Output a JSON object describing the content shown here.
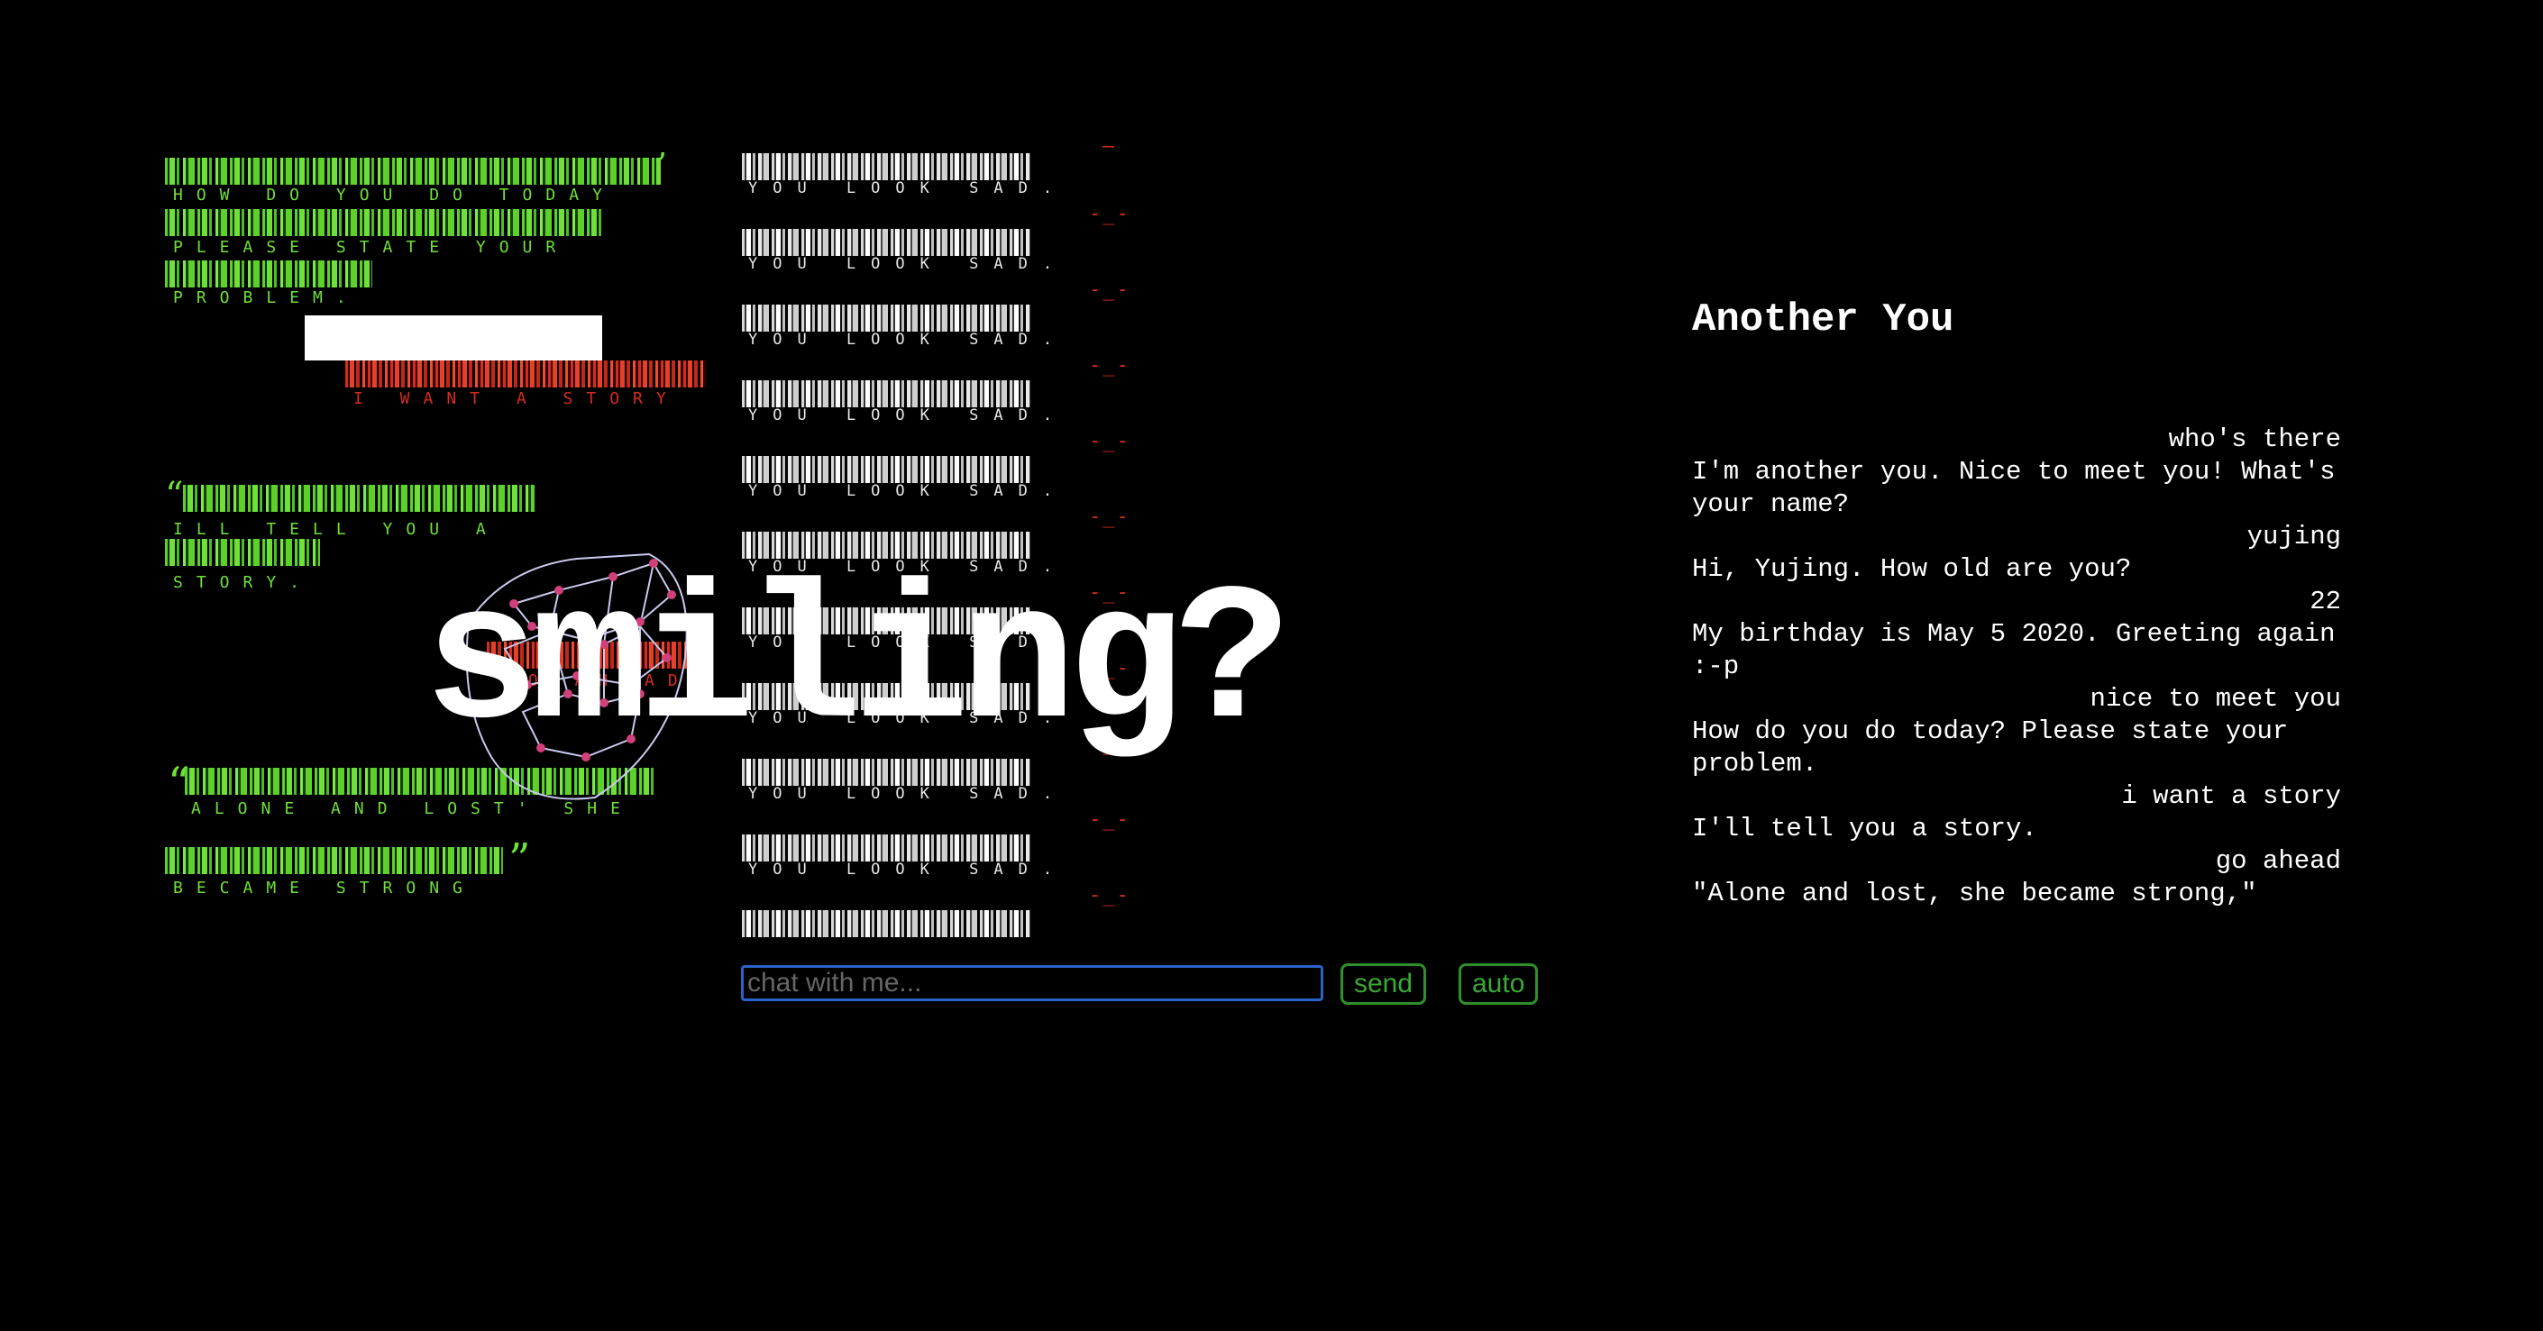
{
  "left_panel": {
    "lines": [
      "HOW DO YOU DO TODAY",
      "PLEASE STATE YOUR",
      "PROBLEM.",
      "I WANT A STORY",
      "ILL TELL YOU A",
      "STORY.",
      "GO AHEAD",
      "ALONE AND LOST' SHE",
      "BECAME STRONG"
    ]
  },
  "middle_panel": {
    "repeat_label": "YOU LOOK SAD.",
    "count": 10
  },
  "overlay_word": "smiling?",
  "chat": {
    "input_placeholder": "chat with me...",
    "send_label": "send",
    "auto_label": "auto"
  },
  "right_panel": {
    "title": "Another You",
    "messages": [
      {
        "from": "user",
        "text": "who's there"
      },
      {
        "from": "bot",
        "text": "I'm another you. Nice to meet you! What's your name?"
      },
      {
        "from": "user",
        "text": "yujing"
      },
      {
        "from": "bot",
        "text": "Hi, Yujing. How old are you?"
      },
      {
        "from": "user",
        "text": "22"
      },
      {
        "from": "bot",
        "text": "My birthday is May 5 2020. Greeting again :-p"
      },
      {
        "from": "user",
        "text": "nice to meet you"
      },
      {
        "from": "bot",
        "text": "How do you do today? Please state your problem."
      },
      {
        "from": "user",
        "text": "i want a story"
      },
      {
        "from": "bot",
        "text": "I'll tell you a story."
      },
      {
        "from": "user",
        "text": "go ahead"
      },
      {
        "from": "bot",
        "text": "\"Alone and lost, she became strong,\""
      }
    ]
  },
  "colors": {
    "green": "#6fe03a",
    "red": "#d62b1f",
    "input_border": "#2a62c9",
    "button_border": "#2f8f2a"
  }
}
